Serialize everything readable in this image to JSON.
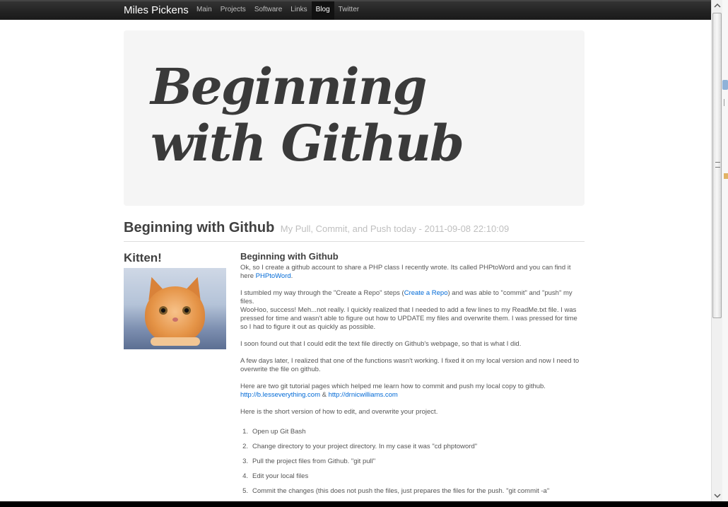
{
  "navbar": {
    "brand": "Miles Pickens",
    "items": [
      {
        "label": "Main",
        "active": false
      },
      {
        "label": "Projects",
        "active": false
      },
      {
        "label": "Software",
        "active": false
      },
      {
        "label": "Links",
        "active": false
      },
      {
        "label": "Blog",
        "active": true
      },
      {
        "label": "Twitter",
        "active": false
      }
    ]
  },
  "hero": {
    "title": "Beginning with Github"
  },
  "page_header": {
    "title": "Beginning with Github",
    "subtitle": "My Pull, Commit, and Push today - 2011-09-08 22:10:09"
  },
  "sidebar": {
    "heading": "Kitten!"
  },
  "article": {
    "heading": "Beginning with Github",
    "p1_text": "Ok, so I create a github account to share a PHP class I recently wrote. Its called PHPtoWord and you can find it here ",
    "p1_link": "PHPtoWord",
    "p1_end": ".",
    "p2_text": "I stumbled my way through the \"Create a Repo\" steps (",
    "p2_link": "Create a Repo",
    "p2_end": ") and was able to \"commit\" and \"push\" my files.",
    "p2_line2": "WooHoo, success! Meh...not really. I quickly realized that I needed to add a few lines to my ReadMe.txt file. I was pressed for time and wasn't able to figure out how to UPDATE my files and overwrite them. I was pressed for time so I had to figure it out as quickly as possible.",
    "p3": "I soon found out that I could edit the text file directly on Github's webpage, so that is what I did.",
    "p4": "A few days later, I realized that one of the functions wasn't working. I fixed it on my local version and now I need to overwrite the file on github.",
    "p5_text": "Here are two git tutorial pages which helped me learn how to commit and push my local copy to github.",
    "p5_link1": "http://b.lesseverything.com",
    "p5_amp": " & ",
    "p5_link2": "http://drnicwilliams.com",
    "p6": "Here is the short version of how to edit, and overwrite your project.",
    "steps": [
      {
        "num": "1.",
        "text": "Open up Git Bash"
      },
      {
        "num": "2.",
        "text": "Change directory to your project directory. In my case it was \"cd phptoword\""
      },
      {
        "num": "3.",
        "text": "Pull the project files from Github. \"git pull\""
      },
      {
        "num": "4.",
        "text": "Edit your local files"
      },
      {
        "num": "5.",
        "text": "Commit the changes (this does not push the files, just prepares the files for the push. \"git commit -a\""
      }
    ]
  },
  "colors": {
    "navbar_bg": "#222222",
    "link": "#0069d6",
    "hero_bg": "#f5f5f5"
  }
}
